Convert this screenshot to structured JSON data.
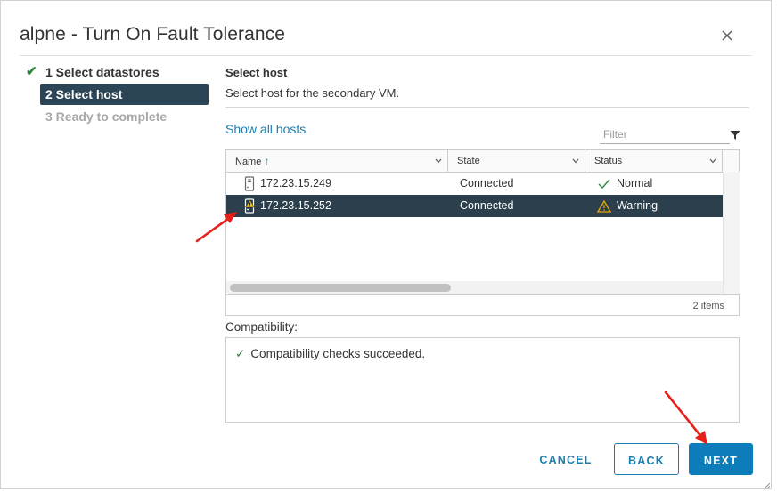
{
  "dialog": {
    "title": "alpne - Turn On Fault Tolerance",
    "close_icon": "close-icon"
  },
  "steps": [
    {
      "label": "1 Select datastores",
      "state": "done"
    },
    {
      "label": "2 Select host",
      "state": "active"
    },
    {
      "label": "3 Ready to complete",
      "state": "disabled"
    }
  ],
  "content": {
    "heading": "Select host",
    "subheading": "Select host for the secondary VM.",
    "show_all_hosts": "Show all hosts",
    "filter_placeholder": "Filter",
    "filter_icon": "filter-icon"
  },
  "grid": {
    "columns": [
      {
        "label": "Name",
        "sorted": "ascending"
      },
      {
        "label": "State"
      },
      {
        "label": "Status"
      }
    ],
    "rows": [
      {
        "name": "172.23.15.249",
        "state": "Connected",
        "status": "Normal",
        "host_icon": "host-icon",
        "status_icon": "check-icon",
        "selected": false
      },
      {
        "name": "172.23.15.252",
        "state": "Connected",
        "status": "Warning",
        "host_icon": "host-warning-icon",
        "status_icon": "warning-icon",
        "selected": true
      }
    ],
    "footer": "2 items"
  },
  "compatibility": {
    "label": "Compatibility:",
    "message": "Compatibility checks succeeded."
  },
  "buttons": {
    "cancel": "CANCEL",
    "back": "BACK",
    "next": "NEXT"
  },
  "colors": {
    "accent": "#0d7cbb",
    "link": "#1a7fb2",
    "nav_active": "#2b4556",
    "row_selected": "#2b3f4c",
    "success": "#2e8540",
    "warning": "#e5a800",
    "annotation_arrow": "#e8201c"
  }
}
